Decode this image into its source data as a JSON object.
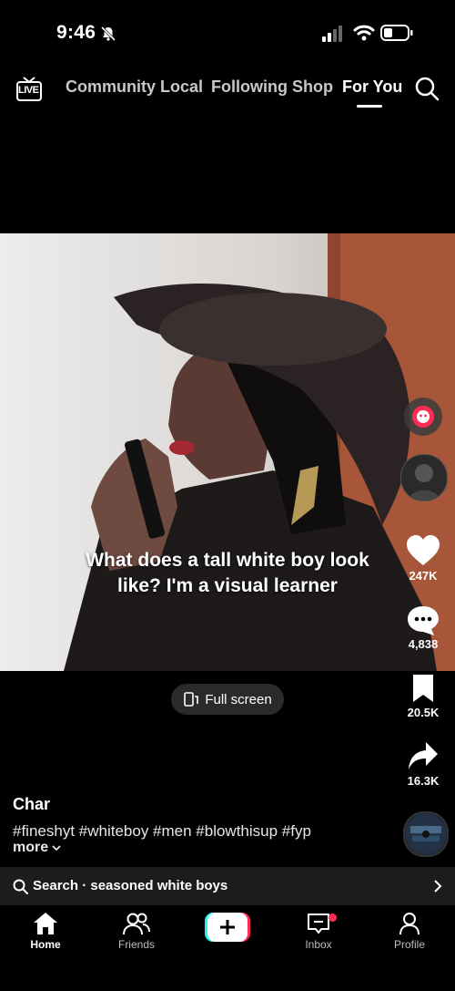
{
  "status_bar": {
    "time": "9:46"
  },
  "top_nav": {
    "live_label": "LIVE",
    "tabs": [
      "Community",
      "Local",
      "Following",
      "Shop",
      "For You"
    ],
    "active_tab": "For You"
  },
  "video": {
    "caption": "What does a tall white boy look like? I'm a visual learner",
    "fullscreen_label": "Full screen"
  },
  "right_rail": {
    "likes": "247K",
    "comments": "4,838",
    "saves": "20.5K",
    "shares": "16.3K"
  },
  "post": {
    "author": "Char",
    "hashtags": "#fineshyt #whiteboy #men #blowthisup #fyp",
    "more_label": "more"
  },
  "search": {
    "text": "Search · seasoned white boys"
  },
  "bottom_nav": {
    "home": "Home",
    "friends": "Friends",
    "inbox": "Inbox",
    "profile": "Profile"
  },
  "colors": {
    "like_red_dot": "#fe2c55",
    "plus_cyan": "#25f4ee",
    "plus_red": "#fe2c55"
  }
}
